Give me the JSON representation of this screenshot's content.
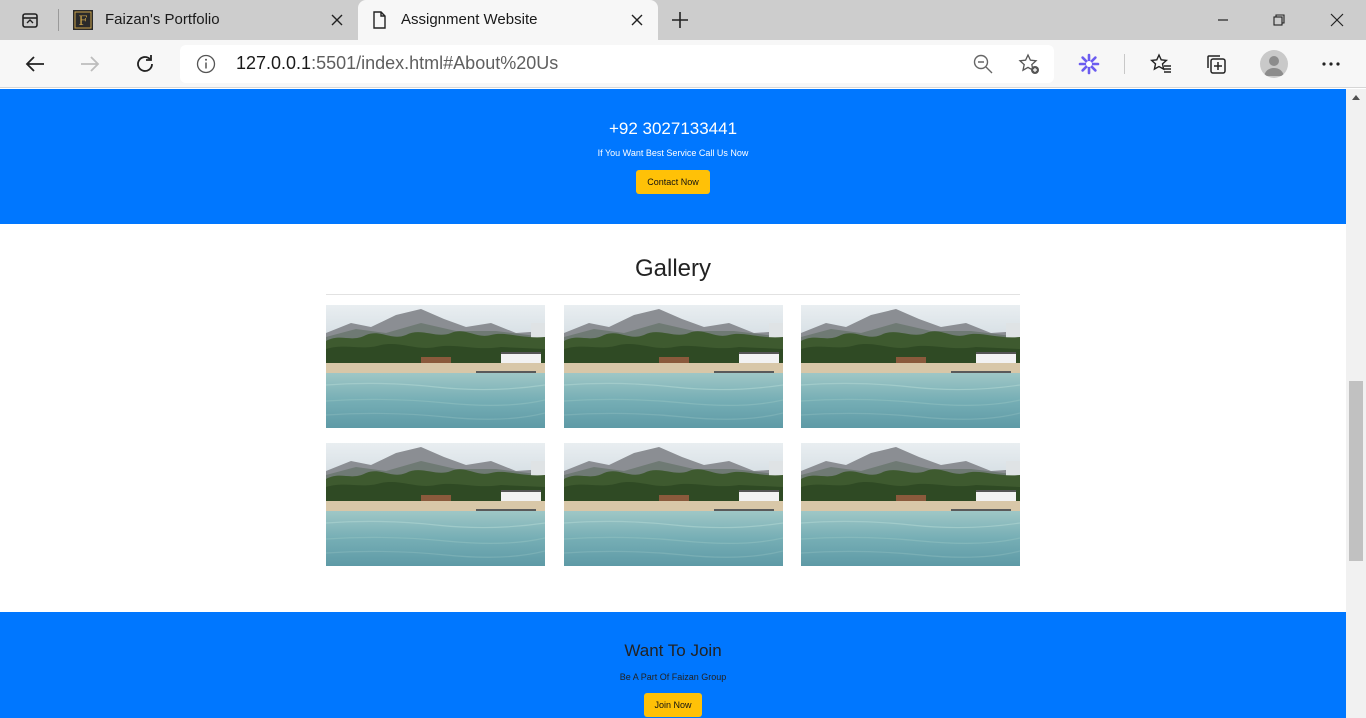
{
  "browser": {
    "tabs": [
      {
        "title": "Faizan's Portfolio",
        "favicon_letter": "F",
        "active": false
      },
      {
        "title": "Assignment Website",
        "active": true
      }
    ],
    "url_host": "127.0.0.1",
    "url_rest": ":5501/index.html#About%20Us"
  },
  "contact": {
    "phone": "+92 3027133441",
    "subtitle": "If You Want Best Service Call Us Now",
    "button_label": "Contact Now"
  },
  "gallery": {
    "title": "Gallery",
    "image_count": 6
  },
  "join": {
    "title": "Want To Join",
    "subtitle": "Be A Part Of Faizan Group",
    "button_label": "Join Now"
  },
  "colors": {
    "section_blue": "#0077ff",
    "button_yellow": "#ffc107"
  }
}
